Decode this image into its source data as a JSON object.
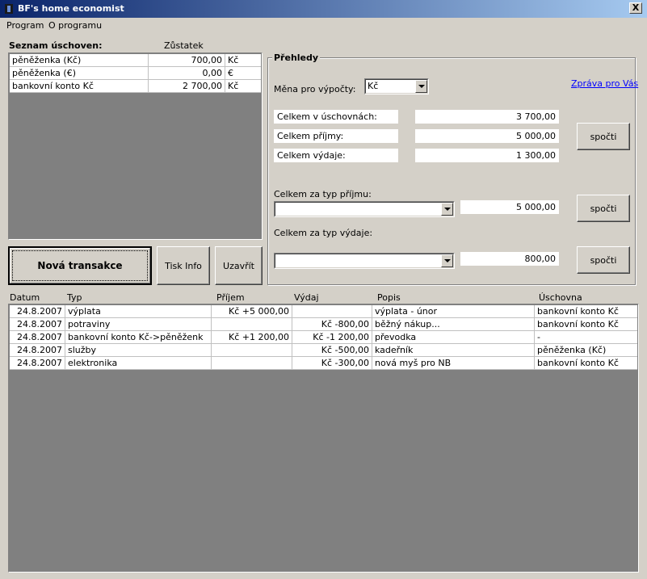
{
  "window": {
    "title": "BF's home economist",
    "close_label": "X"
  },
  "menu": [
    "Program",
    "O programu"
  ],
  "accounts": {
    "header_name": "Seznam úschoven:",
    "header_balance": "Zůstatek",
    "rows": [
      {
        "name": "pěněženka (Kč)",
        "balance": "700,00",
        "currency": "Kč"
      },
      {
        "name": "pěněženka (€)",
        "balance": "0,00",
        "currency": "€"
      },
      {
        "name": "bankovní konto Kč",
        "balance": "2 700,00",
        "currency": "Kč"
      }
    ]
  },
  "buttons": {
    "new_transaction": "Nová transakce",
    "print_info": "Tisk Info",
    "close": "Uzavřít"
  },
  "overview": {
    "title": "Přehledy",
    "currency_label": "Měna pro výpočty:",
    "currency_value": "Kč",
    "report_link": "Zpráva pro Vás",
    "total_accounts_label": "Celkem v úschovnách:",
    "total_accounts_value": "3 700,00",
    "total_income_label": "Celkem příjmy:",
    "total_income_value": "5 000,00",
    "total_expense_label": "Celkem výdaje:",
    "total_expense_value": "1 300,00",
    "compute_label": "spočti",
    "income_type_label": "Celkem za typ příjmu:",
    "income_type_value": "",
    "income_type_total": "5 000,00",
    "expense_type_label": "Celkem za typ výdaje:",
    "expense_type_value": "",
    "expense_type_total": "800,00"
  },
  "transactions": {
    "columns": {
      "date": "Datum",
      "type": "Typ",
      "income": "Příjem",
      "expense": "Výdaj",
      "desc": "Popis",
      "account": "Úschovna"
    },
    "rows": [
      {
        "date": "24.8.2007",
        "type": "výplata",
        "income": "Kč +5 000,00",
        "expense": "",
        "desc": "výplata - únor",
        "account": "bankovní konto Kč"
      },
      {
        "date": "24.8.2007",
        "type": "potraviny",
        "income": "",
        "expense": "Kč -800,00",
        "desc": "běžný nákup...",
        "account": "bankovní konto Kč"
      },
      {
        "date": "24.8.2007",
        "type": "bankovní konto Kč->pěněženk",
        "income": "Kč +1 200,00",
        "expense": "Kč -1 200,00",
        "desc": "převodka",
        "account": "-"
      },
      {
        "date": "24.8.2007",
        "type": "služby",
        "income": "",
        "expense": "Kč -500,00",
        "desc": "kadeřník",
        "account": "pěněženka (Kč)"
      },
      {
        "date": "24.8.2007",
        "type": "elektronika",
        "income": "",
        "expense": "Kč -300,00",
        "desc": "nová myš pro NB",
        "account": "bankovní konto Kč"
      }
    ]
  }
}
